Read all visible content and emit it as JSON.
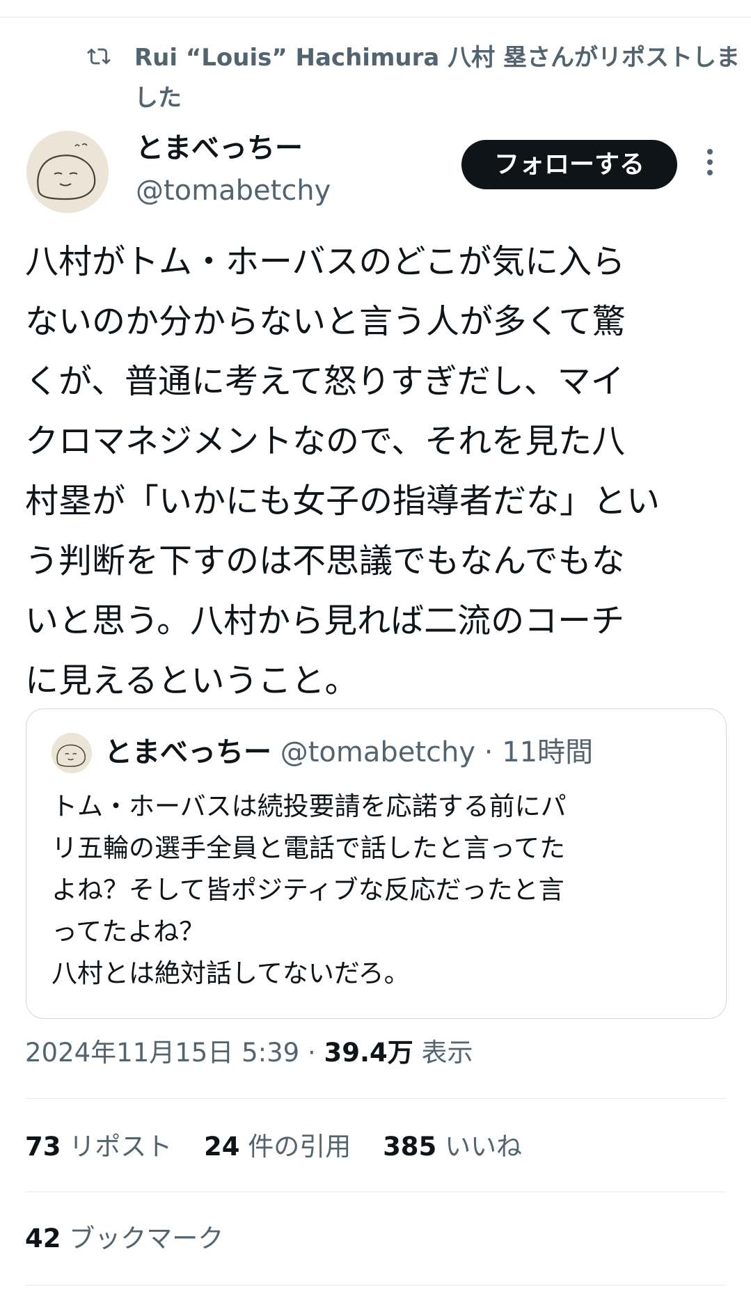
{
  "repost": {
    "icon": "repost-icon",
    "text": "Rui “Louis” Hachimura 八村 塁さんがリポストしました"
  },
  "author": {
    "display_name": "とまべっちー",
    "handle": "@tomabetchy",
    "avatar": "avatar-drawing"
  },
  "follow_button": {
    "label": "フォローする"
  },
  "more_button": {
    "icon": "more-vertical-icon"
  },
  "tweet": {
    "text": "八村がトム・ホーバスのどこが気に入ら\nないのか分からないと言う人が多くて驚\nくが、普通に考えて怒りすぎだし、マイ\nクロマネジメントなので、それを見た八\n村塁が「いかにも女子の指導者だな」とい\nう判断を下すのは不思議でもなんでもな\nいと思う。八村から見れば二流のコーチ\nに見えるということ。"
  },
  "quote": {
    "display_name": "とまべっちー",
    "handle": "@tomabetchy",
    "time": " · 11時間",
    "text": "トム・ホーバスは続投要請を応諾する前にパ\nリ五輪の選手全員と電話で話したと言ってた\nよね？そして皆ポジティブな反応だったと言\nってたよね？\n八村とは絶対話してないだろ。"
  },
  "meta": {
    "datetime": "2024年11月15日 5:39",
    "separator": " · ",
    "views": "39.4万",
    "views_label": "表示"
  },
  "stats": {
    "reposts": {
      "count": "73",
      "label": "リポスト"
    },
    "quotes": {
      "count": "24",
      "label": "件の引用"
    },
    "likes": {
      "count": "385",
      "label": "いいね"
    },
    "bookmarks": {
      "count": "42",
      "label": "ブックマーク"
    }
  },
  "colors": {
    "text": "#0f1419",
    "secondary": "#536471",
    "border": "#cfd9de",
    "button": "#0f1419"
  }
}
